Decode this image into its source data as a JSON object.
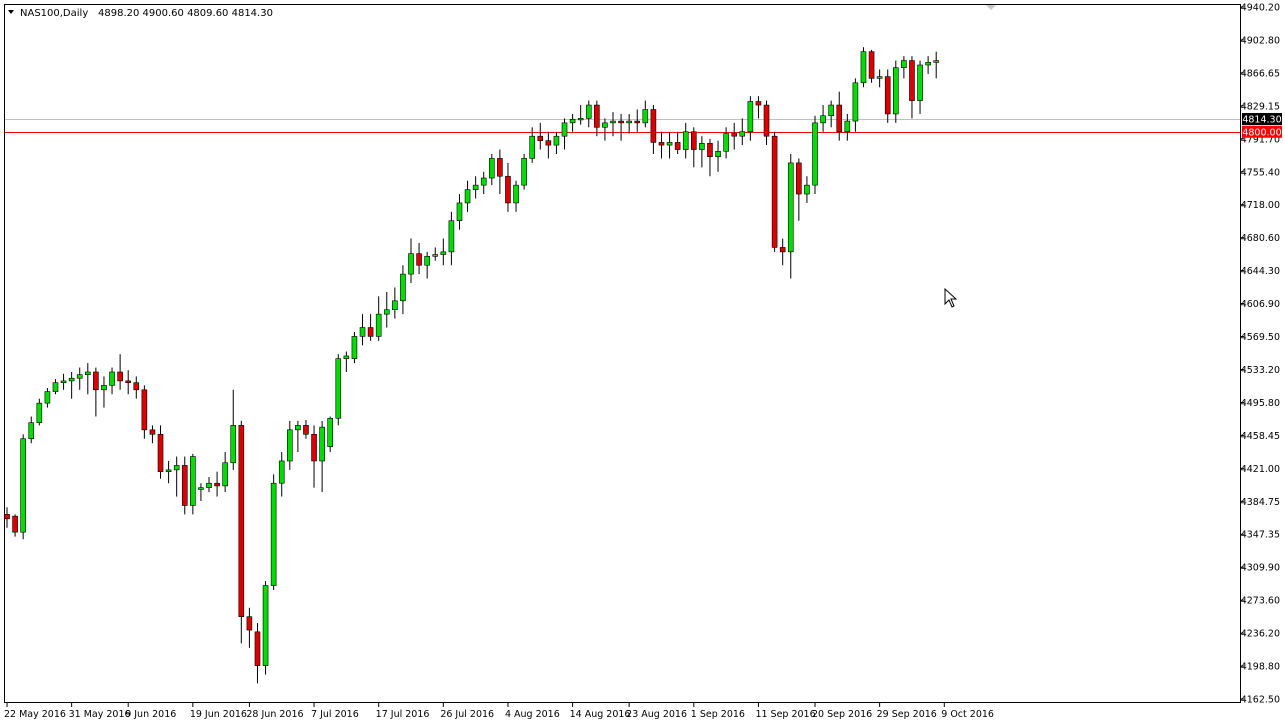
{
  "header": {
    "symbol": "NAS100,Daily",
    "ohlc": "4898.20 4900.60 4809.60 4814.30"
  },
  "colors": {
    "bull": "#00dd00",
    "bear": "#dd0000",
    "wick": "#000000",
    "grid_line": "#c0c0c0",
    "level_line": "#ff0000",
    "background": "#ffffff"
  },
  "chart_data": {
    "type": "candlestick",
    "ylim": [
      4162.5,
      4940.2
    ],
    "y_ticks": [
      "4940.20",
      "4902.80",
      "4866.65",
      "4829.15",
      "4791.70",
      "4755.40",
      "4718.00",
      "4680.60",
      "4644.30",
      "4606.90",
      "4569.50",
      "4533.20",
      "4495.80",
      "4458.45",
      "4421.00",
      "4384.75",
      "4347.35",
      "4309.90",
      "4273.60",
      "4236.20",
      "4198.80",
      "4162.50"
    ],
    "x_labels": [
      {
        "label": "22 May 2016",
        "index": 0
      },
      {
        "label": "31 May 2016",
        "index": 8
      },
      {
        "label": "9 Jun 2016",
        "index": 15
      },
      {
        "label": "19 Jun 2016",
        "index": 23
      },
      {
        "label": "28 Jun 2016",
        "index": 30
      },
      {
        "label": "7 Jul 2016",
        "index": 38
      },
      {
        "label": "17 Jul 2016",
        "index": 46
      },
      {
        "label": "26 Jul 2016",
        "index": 54
      },
      {
        "label": "4 Aug 2016",
        "index": 62
      },
      {
        "label": "14 Aug 2016",
        "index": 70
      },
      {
        "label": "23 Aug 2016",
        "index": 77
      },
      {
        "label": "1 Sep 2016",
        "index": 85
      },
      {
        "label": "11 Sep 2016",
        "index": 93
      },
      {
        "label": "20 Sep 2016",
        "index": 100
      },
      {
        "label": "29 Sep 2016",
        "index": 108
      },
      {
        "label": "9 Oct 2016",
        "index": 116
      }
    ],
    "price_labels": [
      {
        "value": 4814.3,
        "text": "4814.30",
        "style": "dark"
      },
      {
        "value": 4800.0,
        "text": "4800.00",
        "style": "red"
      }
    ],
    "level_lines": [
      {
        "value": 4814.3,
        "color": "#c0c0c0"
      },
      {
        "value": 4800.0,
        "color": "#ff0000"
      }
    ],
    "candles": [
      [
        4370,
        4378,
        4355,
        4365
      ],
      [
        4368,
        4370,
        4345,
        4350
      ],
      [
        4350,
        4460,
        4342,
        4455
      ],
      [
        4455,
        4480,
        4450,
        4473
      ],
      [
        4473,
        4500,
        4470,
        4495
      ],
      [
        4495,
        4512,
        4490,
        4508
      ],
      [
        4508,
        4522,
        4505,
        4518
      ],
      [
        4518,
        4528,
        4510,
        4520
      ],
      [
        4520,
        4530,
        4500,
        4523
      ],
      [
        4523,
        4535,
        4510,
        4527
      ],
      [
        4527,
        4540,
        4505,
        4530
      ],
      [
        4530,
        4535,
        4480,
        4510
      ],
      [
        4510,
        4525,
        4490,
        4515
      ],
      [
        4515,
        4535,
        4505,
        4530
      ],
      [
        4530,
        4550,
        4510,
        4520
      ],
      [
        4520,
        4532,
        4505,
        4518
      ],
      [
        4518,
        4525,
        4500,
        4510
      ],
      [
        4510,
        4515,
        4455,
        4465
      ],
      [
        4465,
        4470,
        4450,
        4460
      ],
      [
        4460,
        4470,
        4410,
        4418
      ],
      [
        4418,
        4430,
        4405,
        4420
      ],
      [
        4420,
        4435,
        4390,
        4425
      ],
      [
        4425,
        4435,
        4370,
        4380
      ],
      [
        4380,
        4438,
        4370,
        4435
      ],
      [
        4398,
        4405,
        4385,
        4400
      ],
      [
        4400,
        4412,
        4395,
        4405
      ],
      [
        4405,
        4418,
        4390,
        4402
      ],
      [
        4402,
        4440,
        4395,
        4428
      ],
      [
        4428,
        4510,
        4420,
        4470
      ],
      [
        4470,
        4475,
        4225,
        4255
      ],
      [
        4255,
        4265,
        4220,
        4240
      ],
      [
        4238,
        4248,
        4180,
        4200
      ],
      [
        4200,
        4295,
        4190,
        4290
      ],
      [
        4290,
        4415,
        4285,
        4405
      ],
      [
        4405,
        4440,
        4390,
        4430
      ],
      [
        4430,
        4475,
        4420,
        4465
      ],
      [
        4465,
        4475,
        4440,
        4470
      ],
      [
        4470,
        4476,
        4455,
        4460
      ],
      [
        4460,
        4470,
        4400,
        4430
      ],
      [
        4430,
        4475,
        4395,
        4468
      ],
      [
        4446,
        4480,
        4440,
        4478
      ],
      [
        4478,
        4550,
        4470,
        4545
      ],
      [
        4545,
        4553,
        4530,
        4548
      ],
      [
        4545,
        4575,
        4540,
        4570
      ],
      [
        4570,
        4595,
        4560,
        4580
      ],
      [
        4580,
        4595,
        4565,
        4570
      ],
      [
        4570,
        4615,
        4565,
        4595
      ],
      [
        4595,
        4620,
        4580,
        4600
      ],
      [
        4600,
        4625,
        4590,
        4610
      ],
      [
        4610,
        4650,
        4595,
        4640
      ],
      [
        4640,
        4680,
        4630,
        4663
      ],
      [
        4663,
        4675,
        4640,
        4650
      ],
      [
        4650,
        4665,
        4635,
        4660
      ],
      [
        4660,
        4670,
        4655,
        4662
      ],
      [
        4662,
        4680,
        4650,
        4665
      ],
      [
        4665,
        4710,
        4650,
        4700
      ],
      [
        4700,
        4730,
        4690,
        4720
      ],
      [
        4720,
        4745,
        4710,
        4735
      ],
      [
        4735,
        4750,
        4725,
        4740
      ],
      [
        4740,
        4755,
        4730,
        4748
      ],
      [
        4748,
        4775,
        4740,
        4770
      ],
      [
        4770,
        4780,
        4730,
        4750
      ],
      [
        4750,
        4765,
        4710,
        4720
      ],
      [
        4720,
        4745,
        4710,
        4740
      ],
      [
        4740,
        4775,
        4735,
        4770
      ],
      [
        4770,
        4805,
        4765,
        4795
      ],
      [
        4795,
        4810,
        4780,
        4790
      ],
      [
        4790,
        4800,
        4770,
        4785
      ],
      [
        4785,
        4800,
        4775,
        4795
      ],
      [
        4795,
        4815,
        4780,
        4810
      ],
      [
        4810,
        4820,
        4800,
        4814
      ],
      [
        4814,
        4830,
        4808,
        4815
      ],
      [
        4815,
        4835,
        4805,
        4830
      ],
      [
        4830,
        4835,
        4795,
        4805
      ],
      [
        4805,
        4815,
        4790,
        4810
      ],
      [
        4810,
        4822,
        4795,
        4812
      ],
      [
        4812,
        4820,
        4790,
        4810
      ],
      [
        4810,
        4820,
        4798,
        4812
      ],
      [
        4812,
        4825,
        4800,
        4810
      ],
      [
        4810,
        4835,
        4805,
        4825
      ],
      [
        4825,
        4830,
        4775,
        4788
      ],
      [
        4788,
        4800,
        4770,
        4785
      ],
      [
        4785,
        4800,
        4770,
        4788
      ],
      [
        4788,
        4800,
        4775,
        4780
      ],
      [
        4780,
        4810,
        4770,
        4800
      ],
      [
        4800,
        4805,
        4760,
        4780
      ],
      [
        4780,
        4795,
        4760,
        4787
      ],
      [
        4787,
        4792,
        4750,
        4772
      ],
      [
        4772,
        4790,
        4755,
        4778
      ],
      [
        4778,
        4805,
        4770,
        4798
      ],
      [
        4798,
        4810,
        4780,
        4795
      ],
      [
        4795,
        4815,
        4785,
        4800
      ],
      [
        4800,
        4840,
        4790,
        4834
      ],
      [
        4834,
        4840,
        4815,
        4830
      ],
      [
        4830,
        4835,
        4785,
        4795
      ],
      [
        4795,
        4800,
        4665,
        4670
      ],
      [
        4670,
        4680,
        4650,
        4665
      ],
      [
        4665,
        4775,
        4635,
        4765
      ],
      [
        4765,
        4770,
        4700,
        4730
      ],
      [
        4730,
        4750,
        4720,
        4740
      ],
      [
        4740,
        4818,
        4730,
        4810
      ],
      [
        4810,
        4830,
        4800,
        4818
      ],
      [
        4818,
        4835,
        4805,
        4830
      ],
      [
        4830,
        4845,
        4790,
        4800
      ],
      [
        4800,
        4820,
        4790,
        4812
      ],
      [
        4812,
        4860,
        4800,
        4855
      ],
      [
        4855,
        4895,
        4850,
        4890
      ],
      [
        4890,
        4892,
        4855,
        4860
      ],
      [
        4860,
        4870,
        4850,
        4862
      ],
      [
        4862,
        4870,
        4810,
        4820
      ],
      [
        4820,
        4880,
        4810,
        4872
      ],
      [
        4872,
        4885,
        4860,
        4880
      ],
      [
        4880,
        4885,
        4815,
        4835
      ],
      [
        4835,
        4880,
        4820,
        4875
      ],
      [
        4875,
        4885,
        4865,
        4878
      ],
      [
        4878,
        4890,
        4860,
        4880
      ]
    ]
  }
}
